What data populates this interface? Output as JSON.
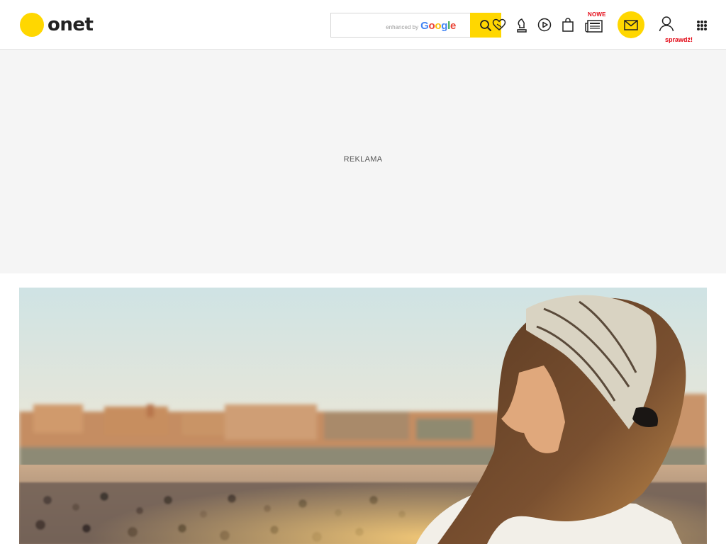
{
  "header": {
    "logo_text": "onet",
    "search": {
      "placeholder": "",
      "brand_small": "enhanced by",
      "brand_google": [
        "G",
        "o",
        "o",
        "g",
        "l",
        "e"
      ]
    },
    "icons": [
      "heart-icon",
      "horoscope-icon",
      "play-icon",
      "shopping-bag-icon",
      "newspaper-icon",
      "mail-icon",
      "user-icon",
      "apps-grid-icon"
    ],
    "newspaper_badge": "NOWE",
    "user_label": "sprawdź!"
  },
  "ad": {
    "label": "REKLAMA"
  },
  "colors": {
    "brand_yellow": "#ffd700",
    "badge_red": "#e30613",
    "ad_background": "#f5f5f5"
  }
}
